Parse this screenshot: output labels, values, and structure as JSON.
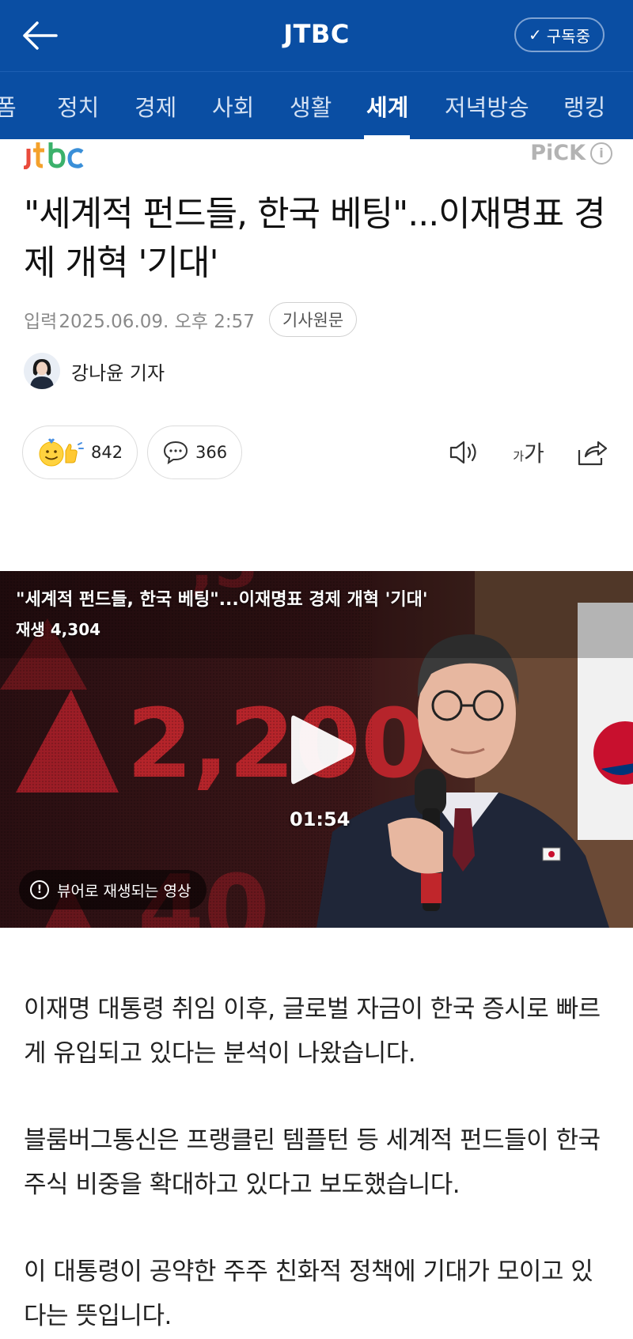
{
  "header": {
    "brand": "JTBC",
    "subscribe_label": "구독중"
  },
  "tabs": [
    {
      "label": "폼"
    },
    {
      "label": "정치"
    },
    {
      "label": "경제"
    },
    {
      "label": "사회"
    },
    {
      "label": "생활"
    },
    {
      "label": "세계",
      "active": true
    },
    {
      "label": "저녁방송"
    },
    {
      "label": "랭킹"
    }
  ],
  "publisher": {
    "logo_text": "jtbc",
    "pick_label": "PiCK",
    "pick_info": "i"
  },
  "article": {
    "title": "\"세계적 펀드들, 한국 베팅\"...이재명표 경제 개혁 '기대'",
    "date_label": "입력",
    "date": "2025.06.09. 오후 2:57",
    "original_button": "기사원문",
    "reporter": "강나윤 기자"
  },
  "reactions": {
    "like_count": "842",
    "comment_count": "366"
  },
  "tools": {
    "font_small": "가",
    "font_large": "가"
  },
  "video": {
    "title": "\"세계적 펀드들, 한국 베팅\"...이재명표 경제 개혁 '기대'",
    "plays": "재생 4,304",
    "duration": "01:54",
    "viewer_note": "뷰어로 재생되는 영상",
    "screen_text": "2,200"
  },
  "body": [
    "이재명 대통령 취임 이후, 글로벌 자금이 한국 증시로 빠르게 유입되고 있다는 분석이 나왔습니다.",
    "블룸버그통신은 프랭클린 템플턴 등 세계적 펀드들이 한국 주식 비중을 확대하고 있다고 보도했습니다.",
    "이 대통령이 공약한 주주 친화적 정책에 기대가 모이고 있다는 뜻입니다."
  ],
  "colors": {
    "header_bg": "#0a4ea3",
    "tab_inactive": "#d4e1f3",
    "meta_gray": "#8a8a8a",
    "video_red": "#c0262b"
  }
}
